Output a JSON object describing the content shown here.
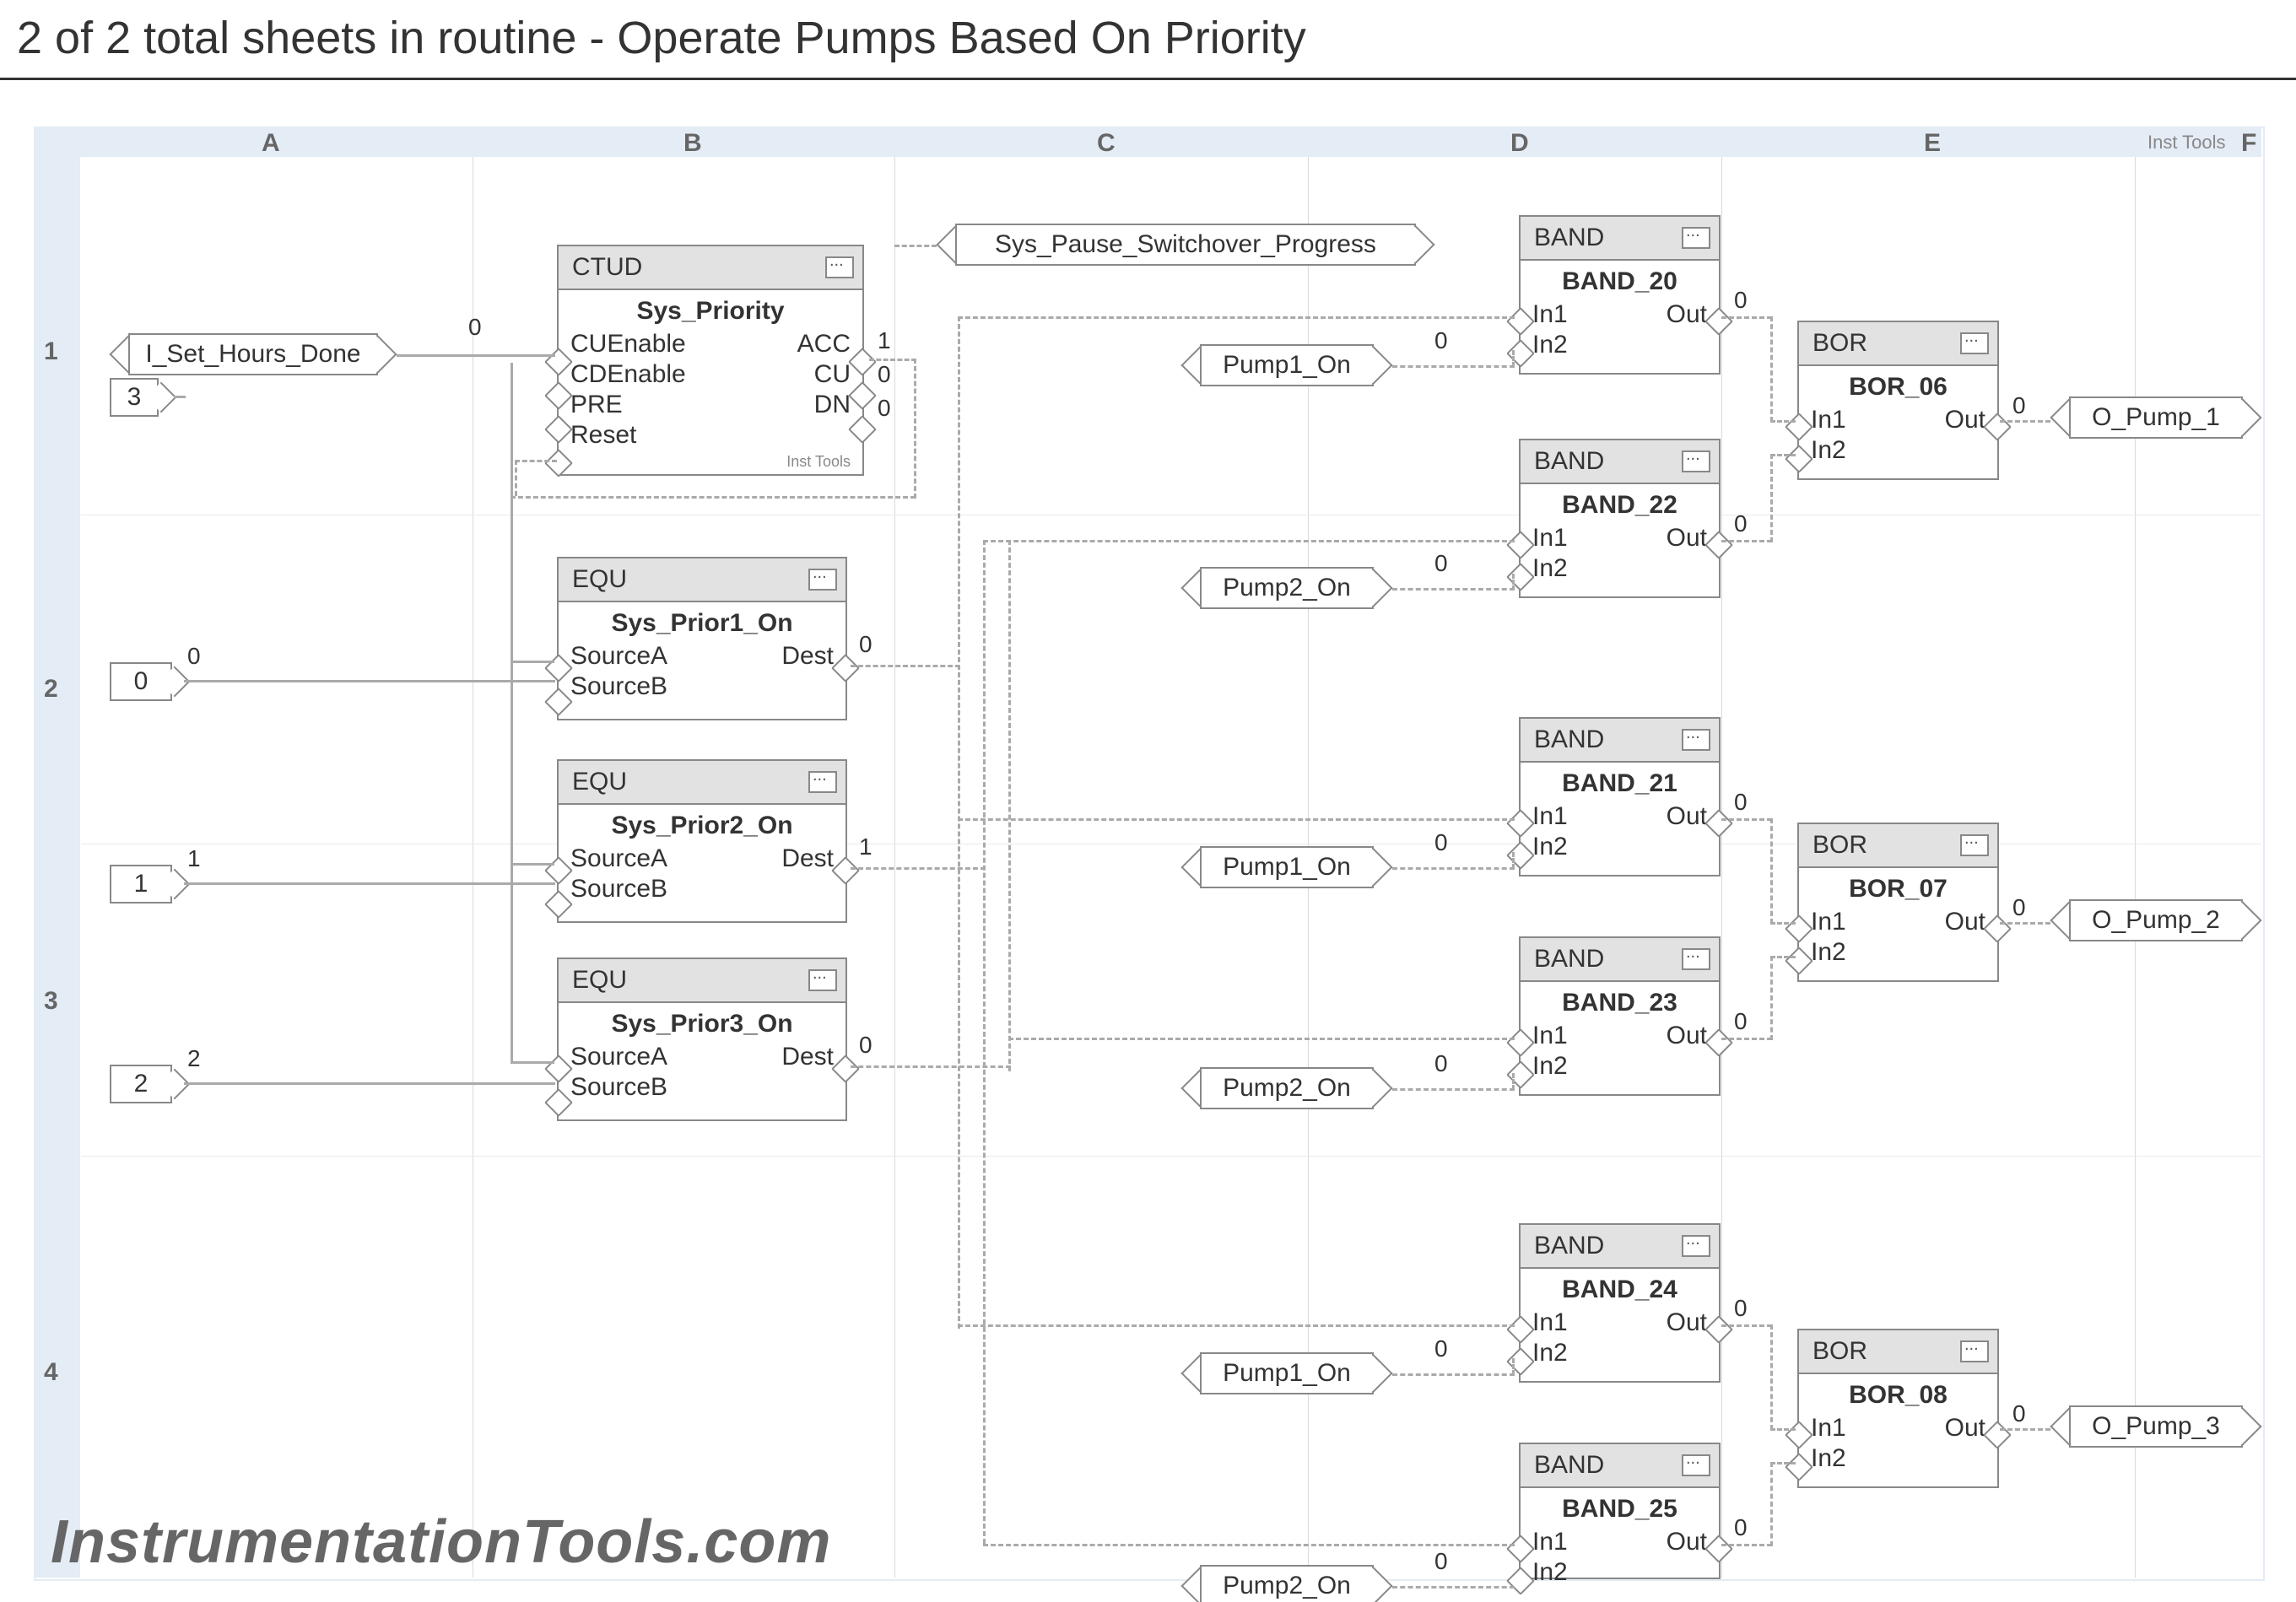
{
  "page_title": "2 of 2 total sheets in routine - Operate Pumps Based On Priority",
  "cols": [
    "A",
    "B",
    "C",
    "D",
    "E",
    "F"
  ],
  "rows": [
    "1",
    "2",
    "3",
    "4"
  ],
  "inst_tools_label": "Inst Tools",
  "watermark": "InstrumentationTools.com",
  "irefs": {
    "i_set_hours_done": {
      "label": "I_Set_Hours_Done",
      "below": "3",
      "wire_value": "0"
    },
    "sys_pause": {
      "label": "Sys_Pause_Switchover_Progress"
    },
    "const0": {
      "label": "0",
      "wire_value": "0"
    },
    "const1": {
      "label": "1",
      "wire_value": "1"
    },
    "const2": {
      "label": "2",
      "wire_value": "2"
    },
    "pump1_on_a": {
      "label": "Pump1_On",
      "wire_value": "0"
    },
    "pump2_on_a": {
      "label": "Pump2_On",
      "wire_value": "0"
    },
    "pump1_on_b": {
      "label": "Pump1_On",
      "wire_value": "0"
    },
    "pump2_on_b": {
      "label": "Pump2_On",
      "wire_value": "0"
    },
    "pump1_on_c": {
      "label": "Pump1_On",
      "wire_value": "0"
    },
    "pump2_on_c": {
      "label": "Pump2_On",
      "wire_value": "0"
    }
  },
  "orefs": {
    "o_pump_1": {
      "label": "O_Pump_1",
      "wire_value": "0"
    },
    "o_pump_2": {
      "label": "O_Pump_2",
      "wire_value": "0"
    },
    "o_pump_3": {
      "label": "O_Pump_3",
      "wire_value": "0"
    }
  },
  "blocks": {
    "ctud": {
      "type": "CTUD",
      "name": "Sys_Priority",
      "left_pins": [
        "CUEnable",
        "CDEnable",
        "PRE",
        "Reset"
      ],
      "right_pins": [
        "ACC",
        "CU",
        "DN"
      ],
      "acc_val": "1",
      "cu_val": "0",
      "dn_val": "0",
      "inst_note": "Inst Tools"
    },
    "equ1": {
      "type": "EQU",
      "name": "Sys_Prior1_On",
      "left": [
        "SourceA",
        "SourceB"
      ],
      "right": [
        "Dest"
      ],
      "dest_val": "0"
    },
    "equ2": {
      "type": "EQU",
      "name": "Sys_Prior2_On",
      "left": [
        "SourceA",
        "SourceB"
      ],
      "right": [
        "Dest"
      ],
      "dest_val": "1"
    },
    "equ3": {
      "type": "EQU",
      "name": "Sys_Prior3_On",
      "left": [
        "SourceA",
        "SourceB"
      ],
      "right": [
        "Dest"
      ],
      "dest_val": "0"
    },
    "band20": {
      "type": "BAND",
      "name": "BAND_20",
      "left": [
        "In1",
        "In2"
      ],
      "right": [
        "Out"
      ],
      "out_val": "0"
    },
    "band22": {
      "type": "BAND",
      "name": "BAND_22",
      "left": [
        "In1",
        "In2"
      ],
      "right": [
        "Out"
      ],
      "out_val": "0"
    },
    "band21": {
      "type": "BAND",
      "name": "BAND_21",
      "left": [
        "In1",
        "In2"
      ],
      "right": [
        "Out"
      ],
      "out_val": "0"
    },
    "band23": {
      "type": "BAND",
      "name": "BAND_23",
      "left": [
        "In1",
        "In2"
      ],
      "right": [
        "Out"
      ],
      "out_val": "0"
    },
    "band24": {
      "type": "BAND",
      "name": "BAND_24",
      "left": [
        "In1",
        "In2"
      ],
      "right": [
        "Out"
      ],
      "out_val": "0"
    },
    "band25": {
      "type": "BAND",
      "name": "BAND_25",
      "left": [
        "In1",
        "In2"
      ],
      "right": [
        "Out"
      ],
      "out_val": "0"
    },
    "bor06": {
      "type": "BOR",
      "name": "BOR_06",
      "left": [
        "In1",
        "In2"
      ],
      "right": [
        "Out"
      ],
      "out_val": "0"
    },
    "bor07": {
      "type": "BOR",
      "name": "BOR_07",
      "left": [
        "In1",
        "In2"
      ],
      "right": [
        "Out"
      ],
      "out_val": "0"
    },
    "bor08": {
      "type": "BOR",
      "name": "BOR_08",
      "left": [
        "In1",
        "In2"
      ],
      "right": [
        "Out"
      ],
      "out_val": "0"
    }
  }
}
